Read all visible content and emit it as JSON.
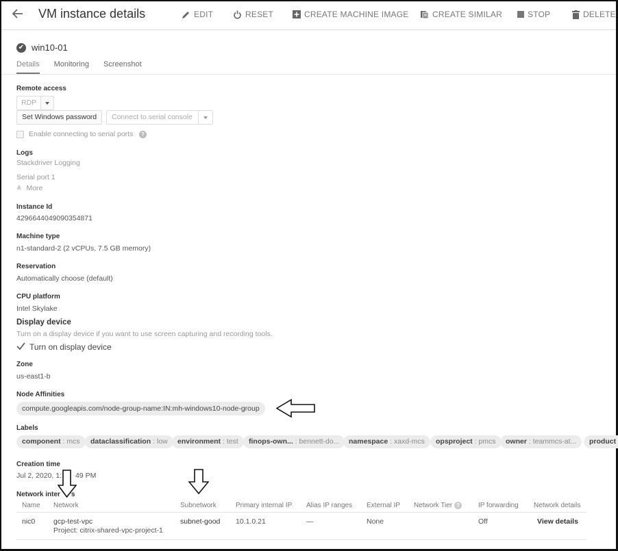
{
  "header": {
    "back_icon": "arrow-left-icon",
    "title": "VM instance details",
    "actions": [
      {
        "label": "EDIT",
        "icon": "pencil-icon"
      },
      {
        "label": "RESET",
        "icon": "power-icon"
      },
      {
        "label": "CREATE MACHINE IMAGE",
        "icon": "add-box-icon"
      },
      {
        "label": "CREATE SIMILAR",
        "icon": "copy-icon"
      },
      {
        "label": "STOP",
        "icon": "stop-icon"
      },
      {
        "label": "DELETE",
        "icon": "trash-icon"
      }
    ]
  },
  "instance": {
    "status_icon": "check-circle-icon",
    "name": "win10-01"
  },
  "tabs": [
    {
      "label": "Details",
      "active": true
    },
    {
      "label": "Monitoring",
      "active": false
    },
    {
      "label": "Screenshot",
      "active": false
    }
  ],
  "remote_access": {
    "label": "Remote access",
    "rdp": "RDP",
    "set_password": "Set Windows password",
    "serial_console": "Connect to serial console",
    "enable_serial": "Enable connecting to serial ports",
    "enable_serial_checked": false
  },
  "logs": {
    "label": "Logs",
    "stackdriver": "Stackdriver Logging",
    "serial_port": "Serial port 1",
    "more": "More"
  },
  "instance_id": {
    "label": "Instance Id",
    "value": "4296644049090354871"
  },
  "machine_type": {
    "label": "Machine type",
    "value": "n1-standard-2 (2 vCPUs, 7.5 GB memory)"
  },
  "reservation": {
    "label": "Reservation",
    "value": "Automatically choose (default)"
  },
  "cpu_platform": {
    "label": "CPU platform",
    "value": "Intel Skylake"
  },
  "display_device": {
    "label": "Display device",
    "description": "Turn on a display device if you want to use screen capturing and recording tools.",
    "checkbox_label": "Turn on display device",
    "checked": true
  },
  "zone": {
    "label": "Zone",
    "value": "us-east1-b"
  },
  "node_affinities": {
    "label": "Node Affinities",
    "value": "compute.googleapis.com/node-group-name:IN:mh-windows10-node-group"
  },
  "labels": {
    "label": "Labels",
    "items": [
      {
        "key": "component",
        "value": "mcs"
      },
      {
        "key": "dataclassification",
        "value": "low"
      },
      {
        "key": "environment",
        "value": "test"
      },
      {
        "key": "finops-own...",
        "value": "bennett-do..."
      },
      {
        "key": "namespace",
        "value": "xaxd-mcs"
      },
      {
        "key": "opsproject",
        "value": "pmcs"
      },
      {
        "key": "owner",
        "value": "teammcs-at..."
      },
      {
        "key": "product",
        "value": ""
      }
    ]
  },
  "creation_time": {
    "label": "Creation time",
    "value_start": "Jul 2, 2020, 1:",
    "value_end": "49 PM"
  },
  "network_interfaces": {
    "label_start": "Network inter",
    "label_end": "s",
    "columns": [
      "Name",
      "Network",
      "Subnetwork",
      "Primary internal IP",
      "Alias IP ranges",
      "External IP",
      "Network Tier",
      "IP forwarding",
      "Network details"
    ],
    "rows": [
      {
        "name": "nic0",
        "network": "gcp-test-vpc",
        "network_project": "Project: citrix-shared-vpc-project-1",
        "subnetwork": "subnet-good",
        "primary_ip": "10.1.0.21",
        "alias_ip": "—",
        "external_ip": "None",
        "network_tier": "",
        "ip_forwarding": "Off",
        "details_link": "View details"
      }
    ]
  },
  "annotations": {
    "arrows": [
      "left-arrow-node-affinities",
      "down-arrow-network",
      "down-arrow-subnetwork"
    ]
  }
}
